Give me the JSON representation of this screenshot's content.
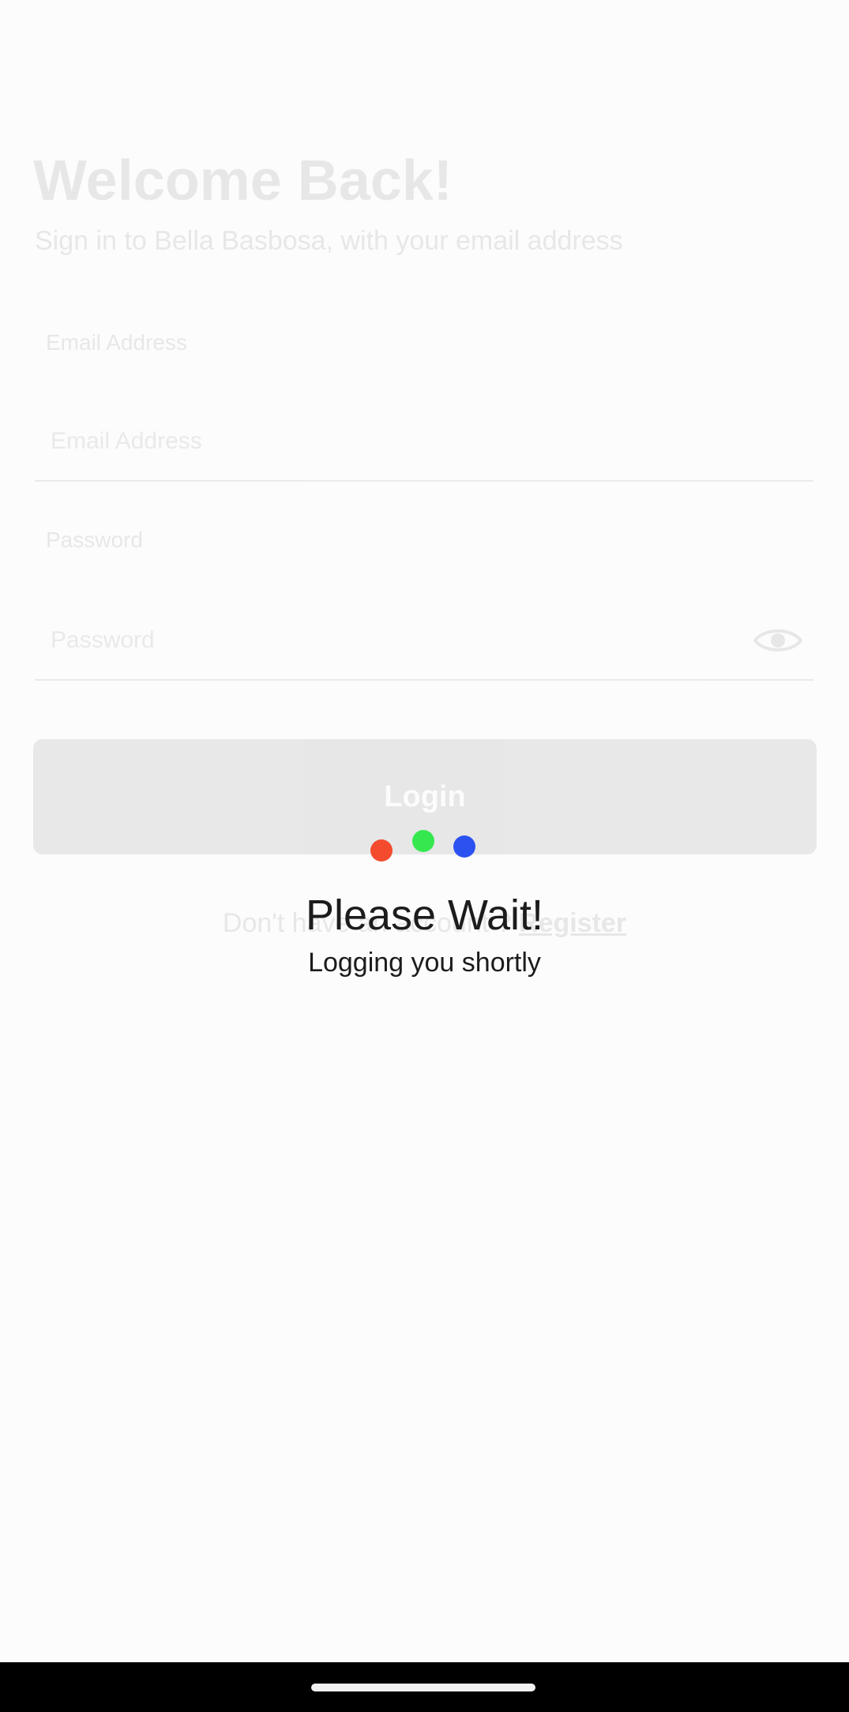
{
  "login": {
    "title": "Welcome Back!",
    "subtitle": "Sign in to Bella Basbosa, with your email address",
    "email_label": "Email Address",
    "email_placeholder": "Email Address",
    "password_label": "Password",
    "password_placeholder": "Password",
    "password_toggle_icon": "eye-icon",
    "login_button_label": "Login",
    "register_prompt": "Don't have an account ? ",
    "register_link": "Register"
  },
  "loading": {
    "title": "Please Wait!",
    "subtitle": "Logging you shortly",
    "dot_colors": [
      "#f44b2e",
      "#35e84f",
      "#2b52f1"
    ]
  },
  "nav_bar": {
    "home_indicator": "home-indicator"
  }
}
